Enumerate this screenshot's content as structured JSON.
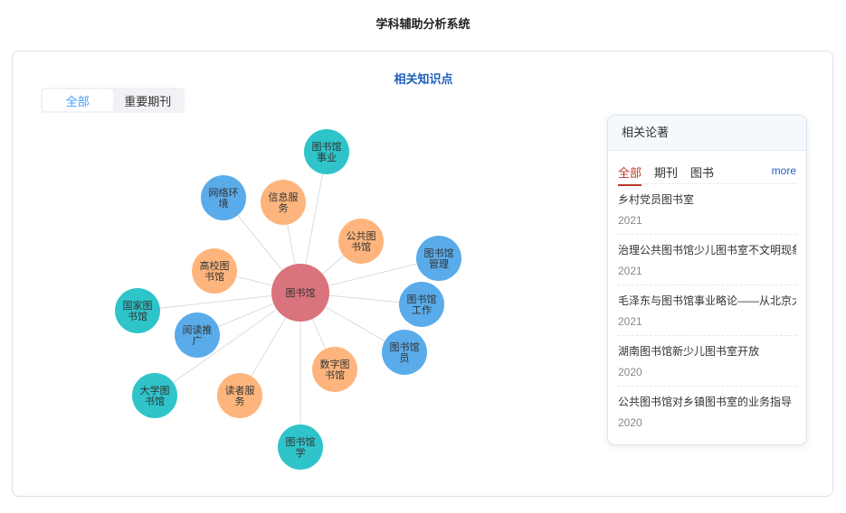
{
  "app": {
    "title": "学科辅助分析系统"
  },
  "section": {
    "title": "相关知识点"
  },
  "filter_tabs": [
    {
      "label": "全部",
      "active": true
    },
    {
      "label": "重要期刊",
      "active": false
    }
  ],
  "graph": {
    "colors": {
      "center": "#d9737c",
      "teal": "#2ec4c9",
      "blue": "#5aabea",
      "orange": "#fdb57d",
      "edge": "#dcdcdc"
    },
    "center": {
      "lines": [
        "图书馆"
      ]
    },
    "nodes": [
      {
        "lines": [
          "图书馆",
          "事业"
        ],
        "color": "teal"
      },
      {
        "lines": [
          "网络环",
          "境"
        ],
        "color": "blue"
      },
      {
        "lines": [
          "信息服",
          "务"
        ],
        "color": "orange"
      },
      {
        "lines": [
          "公共图",
          "书馆"
        ],
        "color": "orange"
      },
      {
        "lines": [
          "图书馆",
          "管理"
        ],
        "color": "blue"
      },
      {
        "lines": [
          "高校图",
          "书馆"
        ],
        "color": "orange"
      },
      {
        "lines": [
          "图书馆",
          "工作"
        ],
        "color": "blue"
      },
      {
        "lines": [
          "国家图",
          "书馆"
        ],
        "color": "teal"
      },
      {
        "lines": [
          "阅读推",
          "广"
        ],
        "color": "blue"
      },
      {
        "lines": [
          "图书馆",
          "员"
        ],
        "color": "blue"
      },
      {
        "lines": [
          "数字图",
          "书馆"
        ],
        "color": "orange"
      },
      {
        "lines": [
          "大学图",
          "书馆"
        ],
        "color": "teal"
      },
      {
        "lines": [
          "读者服",
          "务"
        ],
        "color": "orange"
      },
      {
        "lines": [
          "图书馆",
          "学"
        ],
        "color": "teal"
      }
    ]
  },
  "papers": {
    "header": "相关论著",
    "tabs": [
      {
        "label": "全部",
        "active": true
      },
      {
        "label": "期刊",
        "active": false
      },
      {
        "label": "图书",
        "active": false
      }
    ],
    "more_label": "more",
    "items": [
      {
        "title": "乡村党员图书室",
        "year": "2021"
      },
      {
        "title": "治理公共图书馆少儿图书室不文明现象",
        "year": "2021"
      },
      {
        "title": "毛泽东与图书馆事业略论——从北京大学",
        "year": "2021"
      },
      {
        "title": "湖南图书馆新少儿图书室开放",
        "year": "2020"
      },
      {
        "title": "公共图书馆对乡镇图书室的业务指导",
        "year": "2020"
      }
    ]
  }
}
